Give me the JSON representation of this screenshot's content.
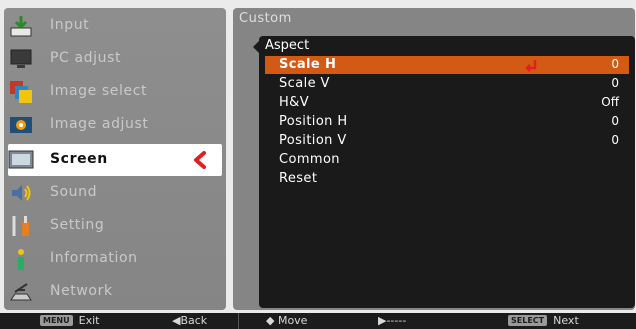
{
  "menu": {
    "items": [
      {
        "label": "Input",
        "icon": "input-icon"
      },
      {
        "label": "PC adjust",
        "icon": "pc-adjust-icon"
      },
      {
        "label": "Image select",
        "icon": "image-select-icon"
      },
      {
        "label": "Image adjust",
        "icon": "image-adjust-icon"
      },
      {
        "label": "Screen",
        "icon": "screen-icon",
        "active": true
      },
      {
        "label": "Sound",
        "icon": "sound-icon"
      },
      {
        "label": "Setting",
        "icon": "setting-icon"
      },
      {
        "label": "Information",
        "icon": "information-icon"
      },
      {
        "label": "Network",
        "icon": "network-icon"
      }
    ]
  },
  "panel": {
    "title": "Custom",
    "submenu_title": "Aspect",
    "rows": [
      {
        "label": "Scale H",
        "value": "0",
        "selected": true
      },
      {
        "label": "Scale V",
        "value": "0"
      },
      {
        "label": "H&V",
        "value": "Off"
      },
      {
        "label": "Position H",
        "value": "0"
      },
      {
        "label": "Position V",
        "value": "0"
      },
      {
        "label": "Common",
        "value": ""
      },
      {
        "label": "Reset",
        "value": ""
      }
    ]
  },
  "bottom": {
    "exit_key": "MENU",
    "exit_label": "Exit",
    "back_label": "◀Back",
    "move_label": "◆ Move",
    "dash_label": "▶-----",
    "next_key": "SELECT",
    "next_label": "Next"
  },
  "colors": {
    "highlight": "#d25a14",
    "arrow": "#e02020",
    "panel_bg": "#858585",
    "submenu_bg": "#1a1a1a"
  }
}
